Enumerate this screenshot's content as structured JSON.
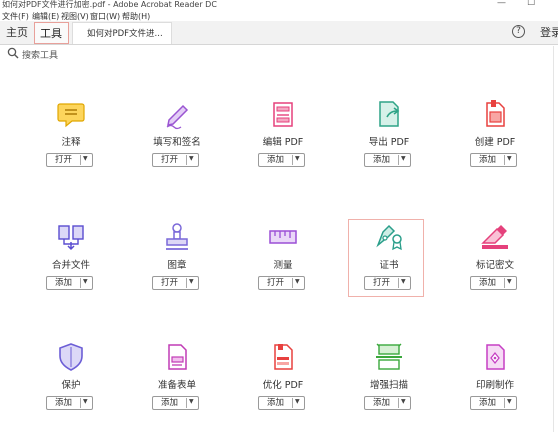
{
  "window": {
    "title": "如何对PDF文件进行加密.pdf - Adobe Acrobat Reader DC",
    "minimize": "—",
    "maximize": "☐"
  },
  "menu": [
    "文件(F)",
    "编辑(E)",
    "视图(V)",
    "窗口(W)",
    "帮助(H)"
  ],
  "tabs": {
    "home": "主页",
    "tools": "工具",
    "document": "如何对PDF文件进..."
  },
  "header_right": {
    "help": "?",
    "login": "登录"
  },
  "search": {
    "placeholder": "搜索工具"
  },
  "tools": [
    {
      "label": "注释",
      "button": "打开",
      "icon": "comment-icon",
      "color": "#f5b800"
    },
    {
      "label": "填写和签名",
      "button": "打开",
      "icon": "fill-sign-icon",
      "color": "#a15cd6"
    },
    {
      "label": "编辑 PDF",
      "button": "添加",
      "icon": "edit-pdf-icon",
      "color": "#e5417c"
    },
    {
      "label": "导出 PDF",
      "button": "添加",
      "icon": "export-pdf-icon",
      "color": "#2fa487"
    },
    {
      "label": "创建 PDF",
      "button": "添加",
      "icon": "create-pdf-icon",
      "color": "#e8413f"
    },
    {
      "label": "合并文件",
      "button": "添加",
      "icon": "combine-files-icon",
      "color": "#5a4dd0"
    },
    {
      "label": "图章",
      "button": "打开",
      "icon": "stamp-icon",
      "color": "#7a68d9"
    },
    {
      "label": "测量",
      "button": "打开",
      "icon": "measure-icon",
      "color": "#9b4fd6"
    },
    {
      "label": "证书",
      "button": "打开",
      "icon": "certificate-icon",
      "color": "#2a9e8a"
    },
    {
      "label": "标记密文",
      "button": "添加",
      "icon": "redact-icon",
      "color": "#e5417c"
    },
    {
      "label": "保护",
      "button": "添加",
      "icon": "protect-icon",
      "color": "#6c5ed6"
    },
    {
      "label": "准备表单",
      "button": "添加",
      "icon": "prepare-form-icon",
      "color": "#c13bb5"
    },
    {
      "label": "优化 PDF",
      "button": "添加",
      "icon": "optimize-pdf-icon",
      "color": "#e8413f"
    },
    {
      "label": "增强扫描",
      "button": "添加",
      "icon": "enhance-scan-icon",
      "color": "#3aa83c"
    },
    {
      "label": "印刷制作",
      "button": "添加",
      "icon": "print-production-icon",
      "color": "#c63fc4"
    }
  ]
}
